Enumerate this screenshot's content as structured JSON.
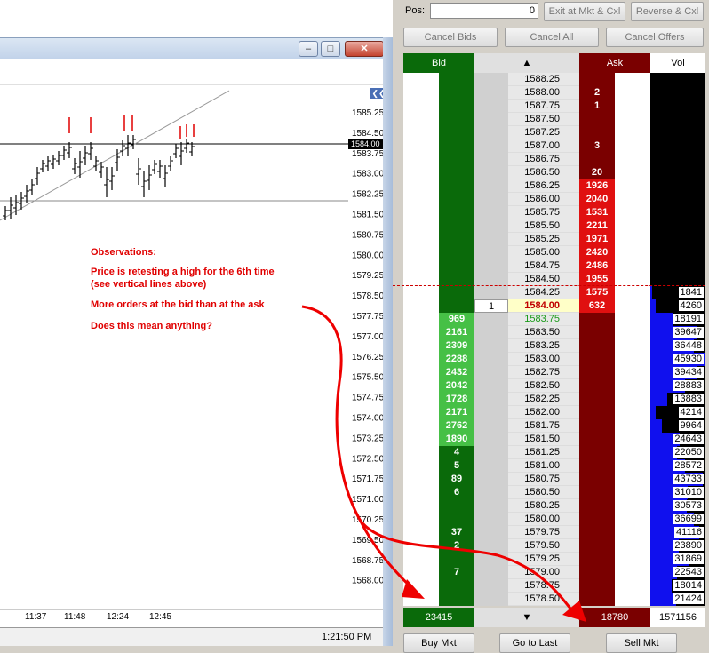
{
  "chart": {
    "price_labels": [
      "1585.25",
      "1584.50",
      "1583.75",
      "1583.00",
      "1582.25",
      "1581.50",
      "1580.75",
      "1580.00",
      "1579.25",
      "1578.50",
      "1577.75",
      "1577.00",
      "1576.25",
      "1575.50",
      "1574.75",
      "1574.00",
      "1573.25",
      "1572.50",
      "1571.75",
      "1571.00",
      "1570.25",
      "1569.50",
      "1568.75",
      "1568.00"
    ],
    "last_price_label": "1584.00",
    "time_labels": [
      "11:37",
      "11:48",
      "12:24",
      "12:45"
    ],
    "status_time": "1:21:50 PM",
    "collapse_glyph": "❮❮"
  },
  "observations": {
    "title": "Observations:",
    "line1": "Price is retesting a high for the 6th time",
    "line2": "(see vertical lines above)",
    "line3": "More orders at the bid than at the ask",
    "line4": "Does this mean anything?"
  },
  "window_buttons": {
    "minimize": "–",
    "maximize": "□",
    "close": "✕"
  },
  "dom": {
    "pos_label": "Pos:",
    "pos_value": "0",
    "exit_label": "Exit at Mkt & Cxl",
    "reverse_label": "Reverse & Cxl",
    "cancel_bids": "Cancel Bids",
    "cancel_all": "Cancel All",
    "cancel_offers": "Cancel Offers",
    "hdr_bid": "Bid",
    "hdr_up": "▲",
    "hdr_ask": "Ask",
    "hdr_vol": "Vol",
    "ft_bid": "23415",
    "ft_down": "▼",
    "ft_ask": "18780",
    "ft_vol": "1571156",
    "buy_mkt": "Buy Mkt",
    "goto_last": "Go to Last",
    "sell_mkt": "Sell Mkt",
    "rows": [
      {
        "price": "1588.25",
        "bid": "",
        "ask": "",
        "vol": ""
      },
      {
        "price": "1588.00",
        "bid": "",
        "ask": "2",
        "vol": ""
      },
      {
        "price": "1587.75",
        "bid": "",
        "ask": "1",
        "vol": ""
      },
      {
        "price": "1587.50",
        "bid": "",
        "ask": "",
        "vol": ""
      },
      {
        "price": "1587.25",
        "bid": "",
        "ask": "",
        "vol": ""
      },
      {
        "price": "1587.00",
        "bid": "",
        "ask": "3",
        "vol": ""
      },
      {
        "price": "1586.75",
        "bid": "",
        "ask": "",
        "vol": ""
      },
      {
        "price": "1586.50",
        "bid": "",
        "ask": "20",
        "vol": ""
      },
      {
        "price": "1586.25",
        "bid": "",
        "ask": "1926",
        "vol": ""
      },
      {
        "price": "1586.00",
        "bid": "",
        "ask": "2040",
        "vol": ""
      },
      {
        "price": "1585.75",
        "bid": "",
        "ask": "1531",
        "vol": ""
      },
      {
        "price": "1585.50",
        "bid": "",
        "ask": "2211",
        "vol": ""
      },
      {
        "price": "1585.25",
        "bid": "",
        "ask": "1971",
        "vol": ""
      },
      {
        "price": "1585.00",
        "bid": "",
        "ask": "2420",
        "vol": ""
      },
      {
        "price": "1584.75",
        "bid": "",
        "ask": "2486",
        "vol": ""
      },
      {
        "price": "1584.50",
        "bid": "",
        "ask": "1955",
        "vol": ""
      },
      {
        "price": "1584.25",
        "bid": "",
        "ask": "1575",
        "vol": "1841"
      },
      {
        "price": "1584.00",
        "bid": "",
        "ask": "632",
        "vol": "4260",
        "myq": "1",
        "last": true
      },
      {
        "price": "1583.75",
        "bid": "969",
        "ask": "",
        "vol": "18191"
      },
      {
        "price": "1583.50",
        "bid": "2161",
        "ask": "",
        "vol": "39647"
      },
      {
        "price": "1583.25",
        "bid": "2309",
        "ask": "",
        "vol": "36448"
      },
      {
        "price": "1583.00",
        "bid": "2288",
        "ask": "",
        "vol": "45930"
      },
      {
        "price": "1582.75",
        "bid": "2432",
        "ask": "",
        "vol": "39434"
      },
      {
        "price": "1582.50",
        "bid": "2042",
        "ask": "",
        "vol": "28883"
      },
      {
        "price": "1582.25",
        "bid": "1728",
        "ask": "",
        "vol": "13883"
      },
      {
        "price": "1582.00",
        "bid": "2171",
        "ask": "",
        "vol": "4214"
      },
      {
        "price": "1581.75",
        "bid": "2762",
        "ask": "",
        "vol": "9964"
      },
      {
        "price": "1581.50",
        "bid": "1890",
        "ask": "",
        "vol": "24643"
      },
      {
        "price": "1581.25",
        "bid": "4",
        "ask": "",
        "vol": "22050"
      },
      {
        "price": "1581.00",
        "bid": "5",
        "ask": "",
        "vol": "28572"
      },
      {
        "price": "1580.75",
        "bid": "89",
        "ask": "",
        "vol": "43733"
      },
      {
        "price": "1580.50",
        "bid": "6",
        "ask": "",
        "vol": "31010"
      },
      {
        "price": "1580.25",
        "bid": "",
        "ask": "",
        "vol": "30573"
      },
      {
        "price": "1580.00",
        "bid": "",
        "ask": "",
        "vol": "36699"
      },
      {
        "price": "1579.75",
        "bid": "37",
        "ask": "",
        "vol": "41116"
      },
      {
        "price": "1579.50",
        "bid": "2",
        "ask": "",
        "vol": "23890"
      },
      {
        "price": "1579.25",
        "bid": "",
        "ask": "",
        "vol": "31869"
      },
      {
        "price": "1579.00",
        "bid": "7",
        "ask": "",
        "vol": "22543"
      },
      {
        "price": "1578.75",
        "bid": "",
        "ask": "",
        "vol": "18014"
      },
      {
        "price": "1578.50",
        "bid": "",
        "ask": "",
        "vol": "21424"
      }
    ]
  },
  "colors": {
    "bid_dark": "#0a6a0a",
    "bid_lit": "#46c046",
    "ask_dark": "#7a0000",
    "ask_lit": "#e01010",
    "vol_bar": "#1010ee",
    "annotation": "#e00000"
  }
}
